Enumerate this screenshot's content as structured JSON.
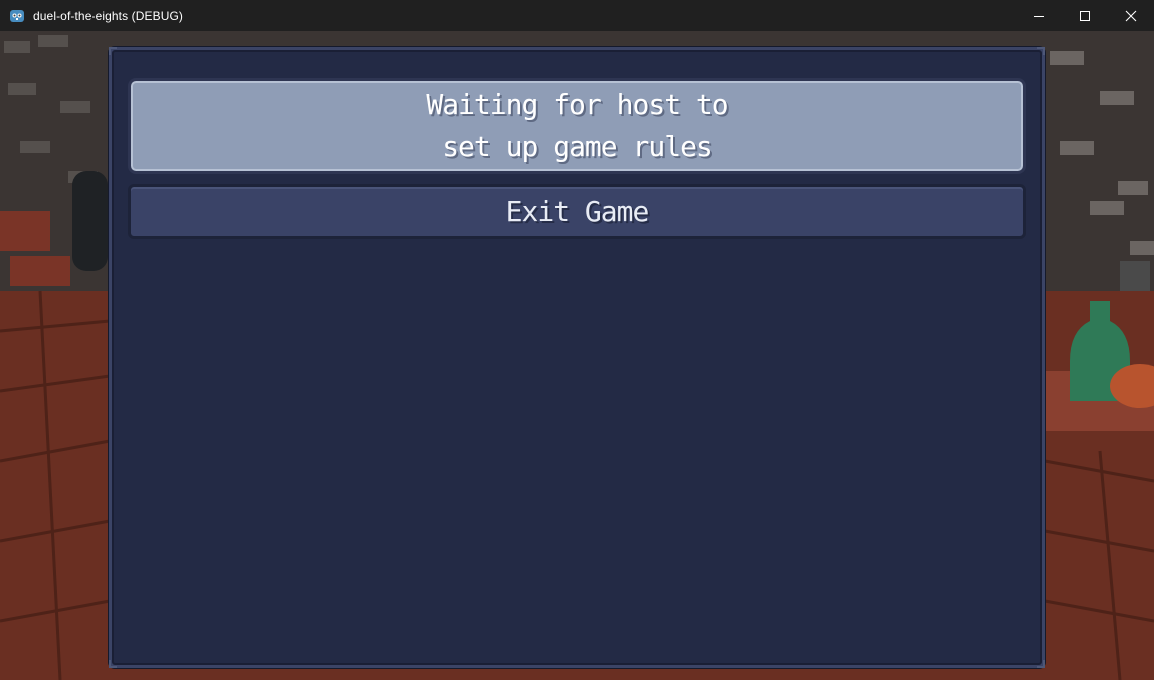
{
  "window": {
    "title": "duel-of-the-eights (DEBUG)",
    "icon": "godot-engine-icon"
  },
  "window_controls": {
    "minimize_icon": "minimize-icon",
    "maximize_icon": "maximize-icon",
    "close_icon": "close-icon"
  },
  "lobby": {
    "status_lines": [
      "Waiting for host to",
      "set up game rules"
    ],
    "exit_label": "Exit Game"
  },
  "colors": {
    "panel_bg": "#232a45",
    "status_bg": "#8f9db6",
    "button_bg": "#3a4367"
  }
}
